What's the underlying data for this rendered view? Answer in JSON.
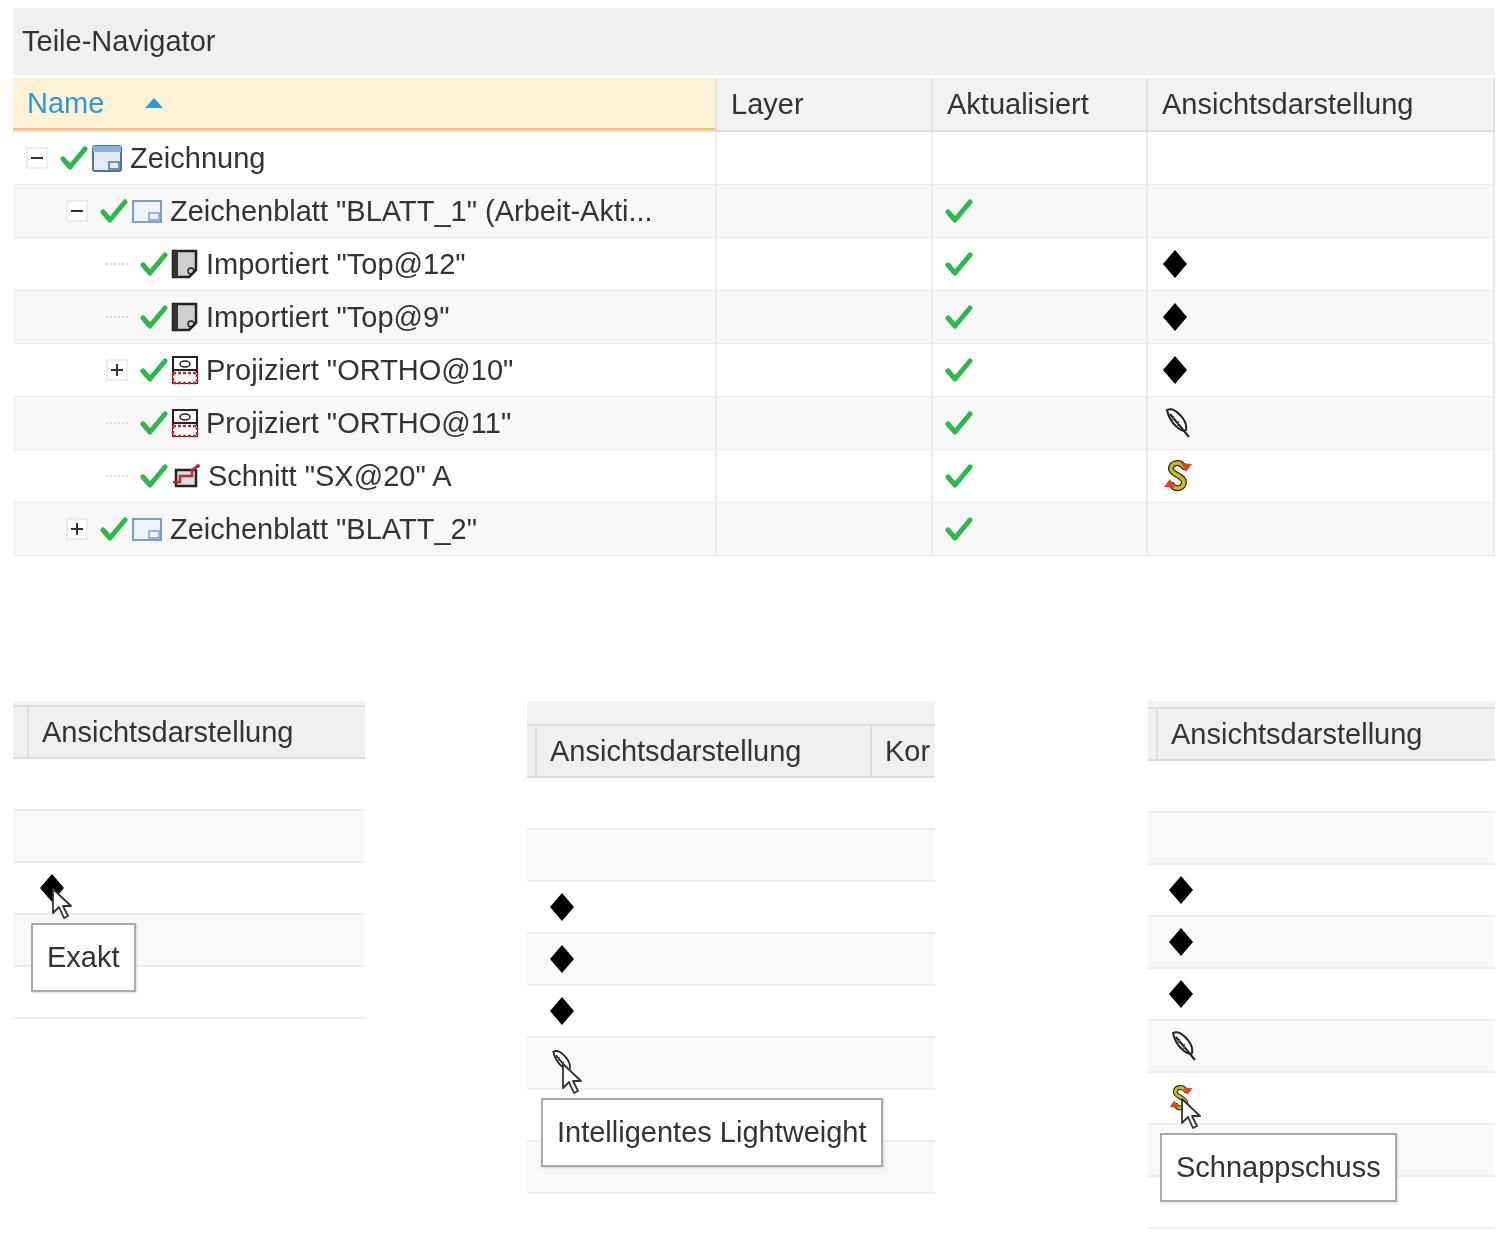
{
  "navigator": {
    "title": "Teile-Navigator",
    "columns": [
      {
        "label": "Name",
        "sorted": true
      },
      {
        "label": "Layer",
        "sorted": false
      },
      {
        "label": "Aktualisiert",
        "sorted": false
      },
      {
        "label": "Ansichtsdarstellung",
        "sorted": false
      }
    ],
    "tree": [
      {
        "label": "Zeichnung",
        "kind": "drawing",
        "ok": true,
        "updated": false,
        "expanded": true,
        "children": [
          {
            "label": "Zeichenblatt \"BLATT_1\" (Arbeit-Akti...",
            "kind": "sheet",
            "ok": true,
            "updated": true,
            "expanded": true,
            "children": [
              {
                "label": "Importiert \"Top@12\"",
                "kind": "imported",
                "ok": true,
                "updated": true,
                "view_mode": {
                  "kind": "exact"
                }
              },
              {
                "label": "Importiert \"Top@9\"",
                "kind": "imported",
                "ok": true,
                "updated": true,
                "view_mode": {
                  "kind": "exact"
                }
              },
              {
                "label": "Projiziert \"ORTHO@10\"",
                "kind": "projected",
                "ok": true,
                "updated": true,
                "view_mode": {
                  "kind": "exact"
                },
                "expanded": false
              },
              {
                "label": "Projiziert \"ORTHO@11\"",
                "kind": "projected",
                "ok": true,
                "updated": true,
                "view_mode": {
                  "kind": "lightweight"
                }
              },
              {
                "label": "Schnitt \"SX@20\" A",
                "kind": "section",
                "ok": true,
                "updated": true,
                "view_mode": {
                  "kind": "snapshot"
                }
              }
            ]
          },
          {
            "label": "Zeichenblatt \"BLATT_2\"",
            "kind": "sheet",
            "ok": true,
            "updated": true,
            "expanded": false
          }
        ]
      }
    ]
  },
  "snippets": [
    {
      "columns": [
        "Ansichtsdarstellung"
      ],
      "tooltip": "Exakt",
      "rows": [
        {
          "hovered": false
        },
        {
          "hovered": false
        },
        {
          "view_mode": {
            "kind": "exact"
          },
          "hovered": true
        },
        {
          "hovered": false
        },
        {
          "hovered": false
        }
      ]
    },
    {
      "columns": [
        "Ansichtsdarstellung",
        "Kor"
      ],
      "tooltip": "Intelligentes Lightweight",
      "rows": [
        {
          "hovered": false
        },
        {
          "hovered": false
        },
        {
          "view_mode": {
            "kind": "exact"
          },
          "hovered": false
        },
        {
          "view_mode": {
            "kind": "exact"
          },
          "hovered": false
        },
        {
          "view_mode": {
            "kind": "exact"
          },
          "hovered": false
        },
        {
          "view_mode": {
            "kind": "lightweight"
          },
          "hovered": true
        },
        {
          "hovered": false
        },
        {
          "hovered": false
        }
      ]
    },
    {
      "columns": [
        "Ansichtsdarstellung"
      ],
      "tooltip": "Schnappschuss",
      "rows": [
        {
          "hovered": false
        },
        {
          "hovered": false
        },
        {
          "view_mode": {
            "kind": "exact"
          },
          "hovered": false
        },
        {
          "view_mode": {
            "kind": "exact"
          },
          "hovered": false
        },
        {
          "view_mode": {
            "kind": "exact"
          },
          "hovered": false
        },
        {
          "view_mode": {
            "kind": "lightweight"
          },
          "hovered": false
        },
        {
          "view_mode": {
            "kind": "snapshot"
          },
          "hovered": true
        },
        {
          "hovered": false
        },
        {
          "hovered": false
        }
      ]
    }
  ]
}
